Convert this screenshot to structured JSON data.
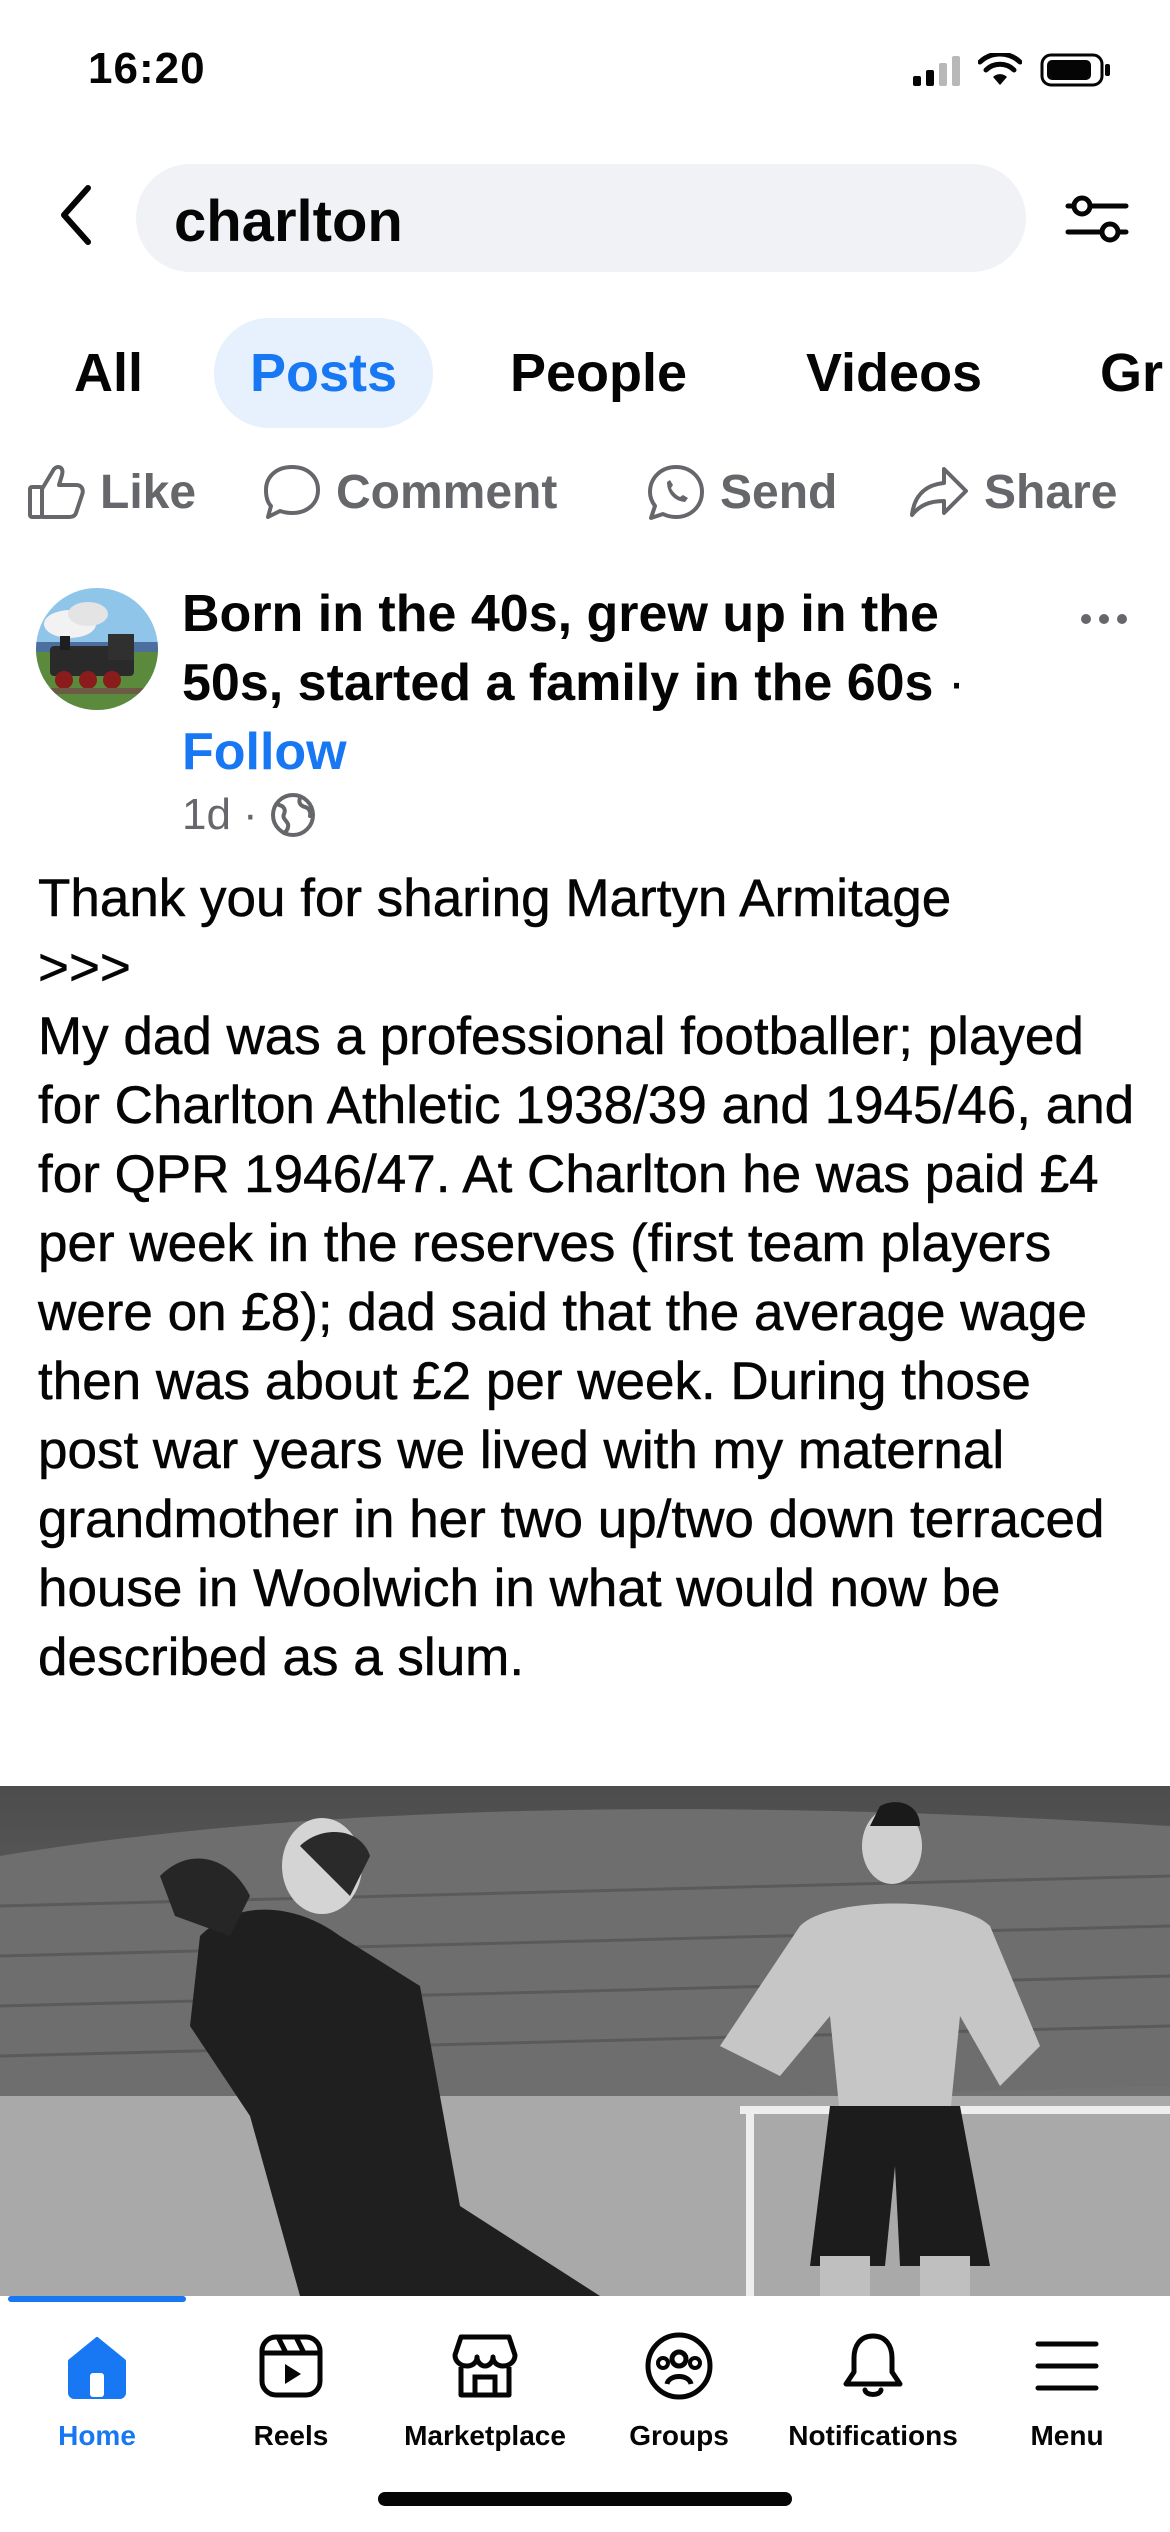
{
  "status_bar": {
    "time": "16:20"
  },
  "search": {
    "query": "charlton"
  },
  "tabs": [
    {
      "label": "All"
    },
    {
      "label": "Posts"
    },
    {
      "label": "People"
    },
    {
      "label": "Videos"
    },
    {
      "label": "Gr"
    }
  ],
  "actions": {
    "like": "Like",
    "comment": "Comment",
    "send": "Send",
    "share": "Share"
  },
  "post": {
    "page_name": "Born in the 40s, grew up in the 50s, started a family in the 60s",
    "separator": " · ",
    "follow_label": "Follow",
    "time": "1d",
    "meta_separator": "·",
    "body": [
      "Thank you for sharing Martyn Armitage",
      ">>>",
      "My dad was a professional footballer; played for Charlton Athletic 1938/39 and 1945/46, and for QPR 1946/47. At Charlton he was paid £4 per week in the reserves (first team players were on £8); dad said that the average wage then was about £2 per week. During those post war years we lived with my maternal grandmother in her two up/two down terraced house in Woolwich in what would now be described as a slum."
    ]
  },
  "bottom_nav": [
    {
      "label": "Home",
      "icon": "home-icon",
      "active": true
    },
    {
      "label": "Reels",
      "icon": "reels-icon"
    },
    {
      "label": "Marketplace",
      "icon": "marketplace-icon"
    },
    {
      "label": "Groups",
      "icon": "groups-icon"
    },
    {
      "label": "Notifications",
      "icon": "bell-icon"
    },
    {
      "label": "Menu",
      "icon": "menu-icon"
    }
  ],
  "colors": {
    "accent": "#1877f2",
    "secondary_text": "#65676b",
    "search_bg": "#f0f2f5",
    "active_tab_bg": "#e7f0fd"
  }
}
